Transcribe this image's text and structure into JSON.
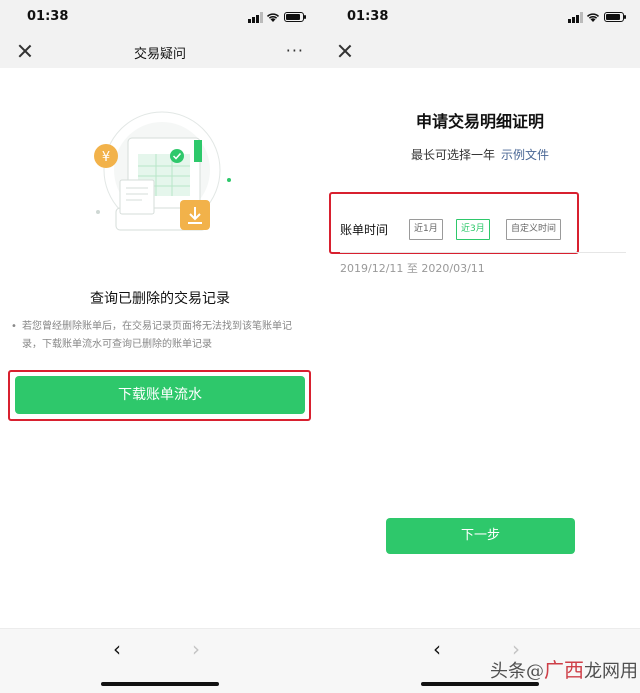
{
  "status_bar": {
    "time": "01:38"
  },
  "left_screen": {
    "nav": {
      "title": "交易疑问",
      "more": "···"
    },
    "illustration": {
      "currency_symbol": "¥"
    },
    "heading": "查询已删除的交易记录",
    "note_bullet": "•",
    "note": "若您曾经删除账单后，在交易记录页面将无法找到该笔账单记录，下载账单流水可查询已删除的账单记录",
    "download_button": "下载账单流水"
  },
  "right_screen": {
    "title": "申请交易明细证明",
    "subtitle": "最长可选择一年",
    "example_link": "示例文件",
    "bill_time_label": "账单时间",
    "options": [
      {
        "label": "近1月",
        "selected": false
      },
      {
        "label": "近3月",
        "selected": true
      },
      {
        "label": "自定义时间",
        "selected": false
      }
    ],
    "date_range": "2019/12/11 至 2020/03/11",
    "next_button": "下一步"
  },
  "bottom_bar": {
    "back": "‹",
    "forward": "›"
  },
  "watermark": {
    "prefix": "头条@",
    "brand_big": "广西",
    "brand_mid": "龙网",
    "suffix": "用"
  },
  "colors": {
    "accent_green": "#2ec86b",
    "highlight_red": "#d8202f",
    "link_blue": "#4a6795"
  }
}
